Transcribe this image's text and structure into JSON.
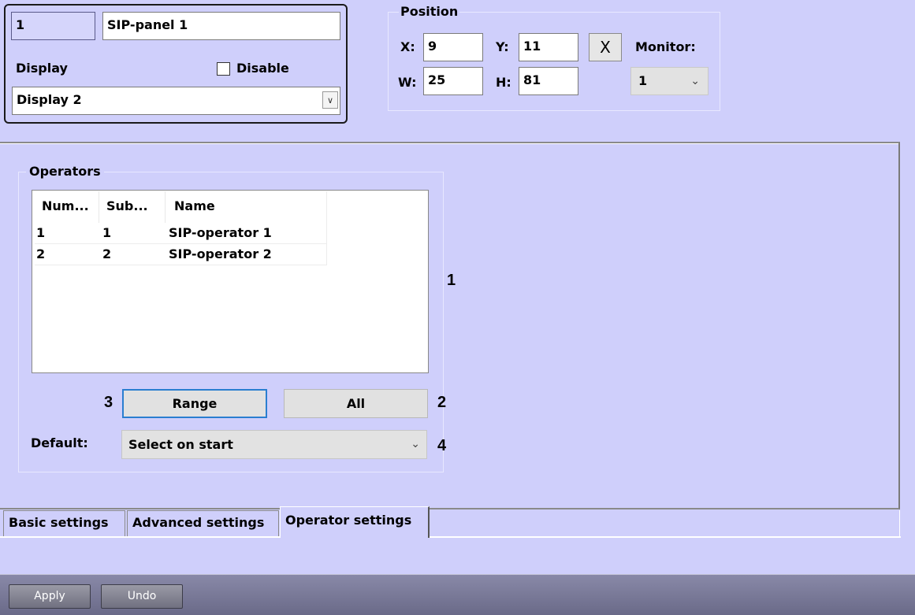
{
  "object": {
    "number": "1",
    "name": "SIP-panel 1",
    "display_label": "Display",
    "disable_label": "Disable",
    "disable_checked": false,
    "display_value": "Display 2"
  },
  "position": {
    "title": "Position",
    "x_label": "X:",
    "x_value": "9",
    "y_label": "Y:",
    "y_value": "11",
    "w_label": "W:",
    "w_value": "25",
    "h_label": "H:",
    "h_value": "81",
    "reset_label": "X",
    "monitor_label": "Monitor:",
    "monitor_value": "1"
  },
  "operators": {
    "title": "Operators",
    "columns": [
      "Num...",
      "Sub...",
      "Name"
    ],
    "rows": [
      [
        "1",
        "1",
        "SIP-operator 1"
      ],
      [
        "2",
        "2",
        "SIP-operator 2"
      ]
    ],
    "range_label": "Range",
    "all_label": "All",
    "default_label": "Default:",
    "default_value": "Select on start"
  },
  "callouts": {
    "c1": "1",
    "c2": "2",
    "c3": "3",
    "c4": "4"
  },
  "tabs": [
    {
      "label": "Basic settings"
    },
    {
      "label": "Advanced settings"
    },
    {
      "label": "Operator settings",
      "active": true
    }
  ],
  "footer": {
    "apply_label": "Apply",
    "undo_label": "Undo"
  }
}
